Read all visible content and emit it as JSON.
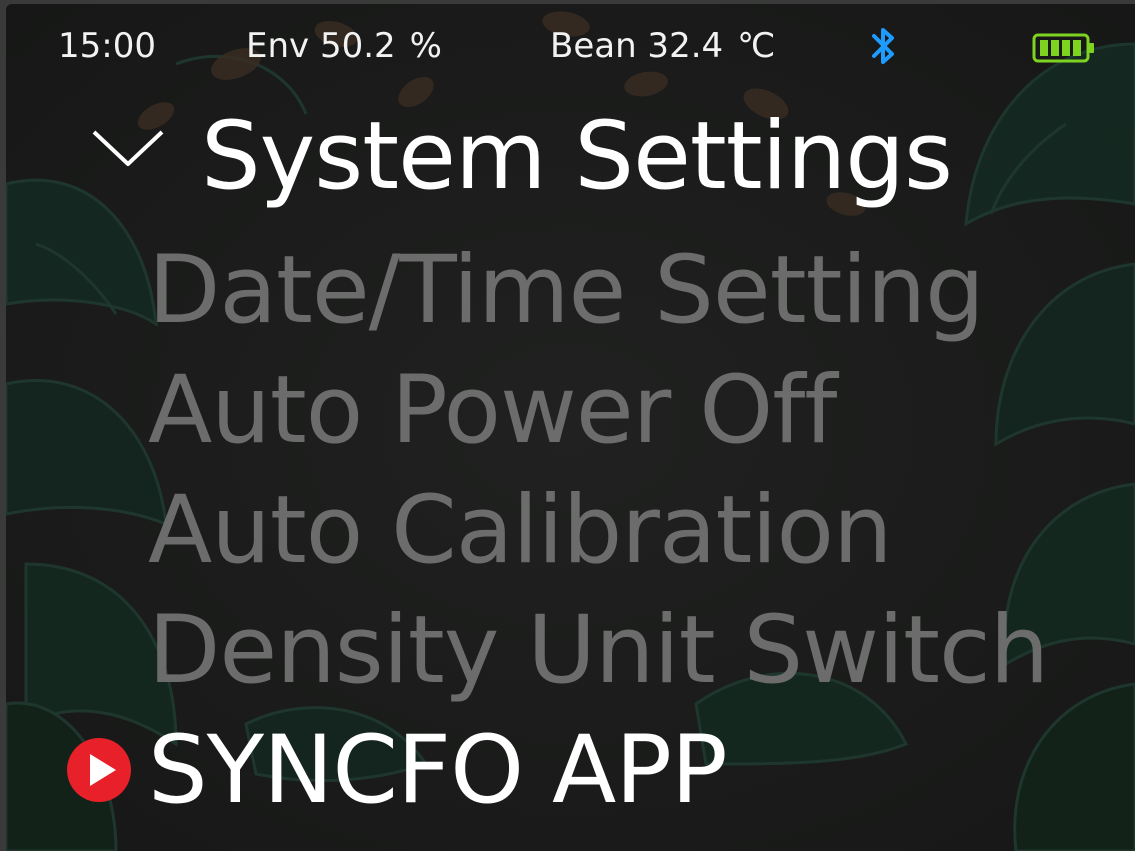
{
  "status": {
    "time": "15:00",
    "env_label": "Env 50.2",
    "env_unit": "%",
    "bean_label": "Bean 32.4",
    "bean_unit": "℃",
    "bluetooth_icon": "bluetooth-icon",
    "battery_icon": "battery-full-icon",
    "battery_color": "#7ed321",
    "bluetooth_color": "#1e9bff"
  },
  "header": {
    "title": "System Settings",
    "back_icon": "chevron-down-icon"
  },
  "menu": {
    "items": [
      {
        "label": "Date/Time Setting"
      },
      {
        "label": "Auto Power Off"
      },
      {
        "label": "Auto Calibration"
      },
      {
        "label": "Density Unit Switch"
      },
      {
        "label": "SYNCFO APP"
      }
    ],
    "selected_index": 4,
    "selector_icon": "play-circle-icon",
    "selector_color": "#e8202a",
    "inactive_color": "#6c6c6c",
    "active_color": "#ffffff"
  }
}
